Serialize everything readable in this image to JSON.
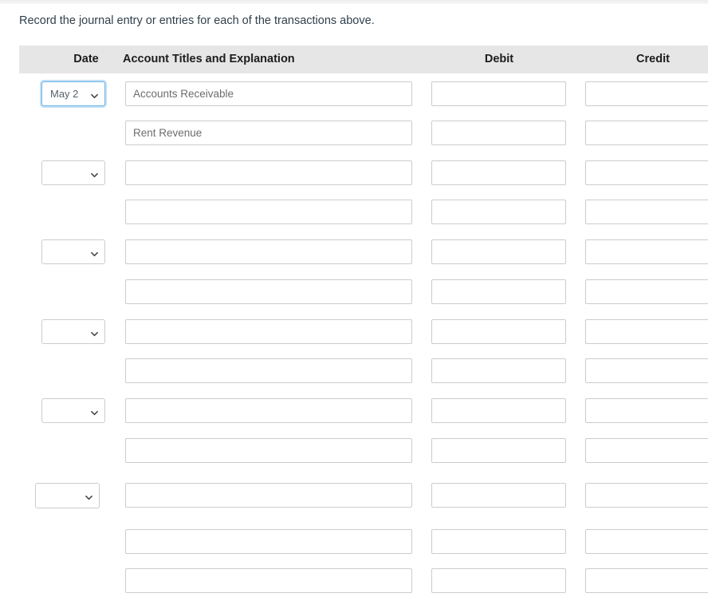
{
  "instruction": "Record the journal entry or entries for each of the transactions above.",
  "table": {
    "headers": {
      "date": "Date",
      "account": "Account Titles and Explanation",
      "debit": "Debit",
      "credit": "Credit"
    },
    "colors": {
      "header_background": "#e6e6e6",
      "header_text": "#1c1c1c",
      "input_border": "#cccccc",
      "input_text": "#6d6d6d",
      "focus_border": "#6db7e8",
      "body_text": "#31404b"
    },
    "icons": {
      "dropdown": "chevron-down-icon"
    },
    "rows": [
      {
        "index": 0,
        "has_date_select": true,
        "date_value": "May 2",
        "date_placeholder": "",
        "date_focused": true,
        "date_wide": false,
        "account_value": "Accounts Receivable",
        "account_placeholder": "",
        "debit_value": "",
        "debit_placeholder": "",
        "credit_value": "",
        "credit_placeholder": ""
      },
      {
        "index": 1,
        "has_date_select": false,
        "date_value": "",
        "date_placeholder": "",
        "date_focused": false,
        "date_wide": false,
        "account_value": "Rent Revenue",
        "account_placeholder": "",
        "debit_value": "",
        "debit_placeholder": "",
        "credit_value": "",
        "credit_placeholder": ""
      },
      {
        "index": 2,
        "has_date_select": true,
        "date_value": "",
        "date_placeholder": "",
        "date_focused": false,
        "date_wide": false,
        "account_value": "",
        "account_placeholder": "",
        "debit_value": "",
        "debit_placeholder": "",
        "credit_value": "",
        "credit_placeholder": ""
      },
      {
        "index": 3,
        "has_date_select": false,
        "date_value": "",
        "date_placeholder": "",
        "date_focused": false,
        "date_wide": false,
        "account_value": "",
        "account_placeholder": "",
        "debit_value": "",
        "debit_placeholder": "",
        "credit_value": "",
        "credit_placeholder": ""
      },
      {
        "index": 4,
        "has_date_select": true,
        "date_value": "",
        "date_placeholder": "",
        "date_focused": false,
        "date_wide": false,
        "account_value": "",
        "account_placeholder": "",
        "debit_value": "",
        "debit_placeholder": "",
        "credit_value": "",
        "credit_placeholder": ""
      },
      {
        "index": 5,
        "has_date_select": false,
        "date_value": "",
        "date_placeholder": "",
        "date_focused": false,
        "date_wide": false,
        "account_value": "",
        "account_placeholder": "",
        "debit_value": "",
        "debit_placeholder": "",
        "credit_value": "",
        "credit_placeholder": ""
      },
      {
        "index": 6,
        "has_date_select": true,
        "date_value": "",
        "date_placeholder": "",
        "date_focused": false,
        "date_wide": false,
        "account_value": "",
        "account_placeholder": "",
        "debit_value": "",
        "debit_placeholder": "",
        "credit_value": "",
        "credit_placeholder": ""
      },
      {
        "index": 7,
        "has_date_select": false,
        "date_value": "",
        "date_placeholder": "",
        "date_focused": false,
        "date_wide": false,
        "account_value": "",
        "account_placeholder": "",
        "debit_value": "",
        "debit_placeholder": "",
        "credit_value": "",
        "credit_placeholder": ""
      },
      {
        "index": 8,
        "has_date_select": true,
        "date_value": "",
        "date_placeholder": "",
        "date_focused": false,
        "date_wide": false,
        "account_value": "",
        "account_placeholder": "",
        "debit_value": "",
        "debit_placeholder": "",
        "credit_value": "",
        "credit_placeholder": ""
      },
      {
        "index": 9,
        "has_date_select": false,
        "date_value": "",
        "date_placeholder": "",
        "date_focused": false,
        "date_wide": false,
        "account_value": "",
        "account_placeholder": "",
        "debit_value": "",
        "debit_placeholder": "",
        "credit_value": "",
        "credit_placeholder": ""
      },
      {
        "index": 10,
        "has_date_select": true,
        "date_value": "",
        "date_placeholder": "",
        "date_focused": false,
        "date_wide": true,
        "account_value": "",
        "account_placeholder": "",
        "debit_value": "",
        "debit_placeholder": "",
        "credit_value": "",
        "credit_placeholder": ""
      },
      {
        "index": 11,
        "has_date_select": false,
        "date_value": "",
        "date_placeholder": "",
        "date_focused": false,
        "date_wide": false,
        "account_value": "",
        "account_placeholder": "",
        "debit_value": "",
        "debit_placeholder": "",
        "credit_value": "",
        "credit_placeholder": ""
      },
      {
        "index": 12,
        "has_date_select": false,
        "date_value": "",
        "date_placeholder": "",
        "date_focused": false,
        "date_wide": false,
        "account_value": "",
        "account_placeholder": "",
        "debit_value": "",
        "debit_placeholder": "",
        "credit_value": "",
        "credit_placeholder": ""
      }
    ],
    "row_tops": [
      0,
      49,
      99,
      148,
      198,
      248,
      298,
      347,
      397,
      447,
      503,
      561,
      610
    ]
  }
}
